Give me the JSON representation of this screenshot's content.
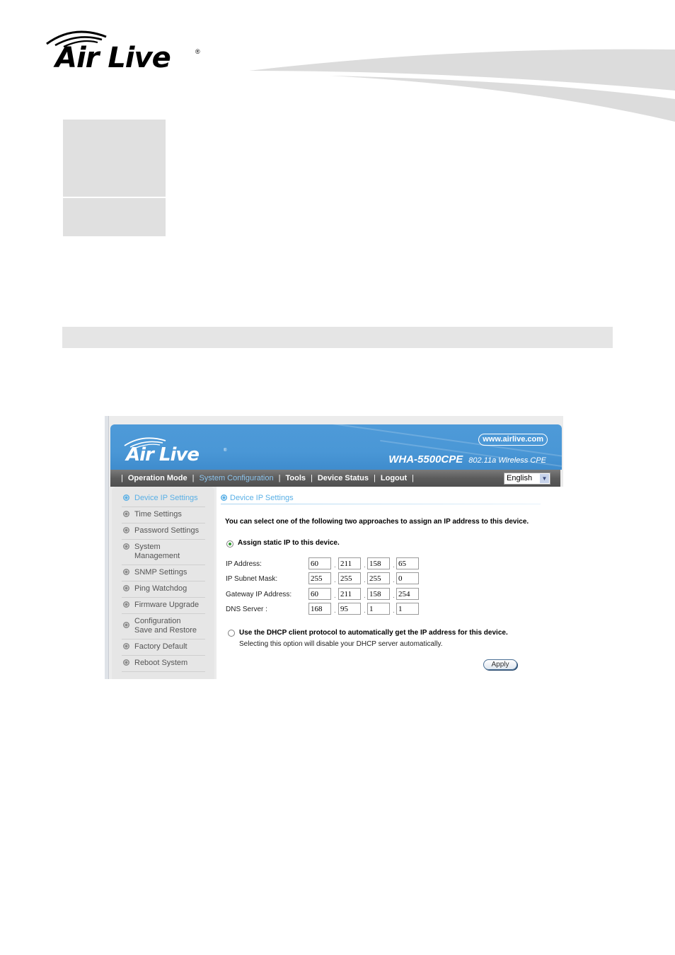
{
  "page": {
    "brand": "Air Live",
    "brand_mark": "®"
  },
  "device_ui": {
    "banner": {
      "brand": "Air Live",
      "brand_mark": "®",
      "url": "www.airlive.com",
      "model": "WHA-5500CPE",
      "model_desc": "802.11a Wireless CPE"
    },
    "nav": {
      "separator": "|",
      "items": [
        {
          "label": "Operation Mode",
          "active": false
        },
        {
          "label": "System Configuration",
          "active": true
        },
        {
          "label": "Tools",
          "active": false
        },
        {
          "label": "Device Status",
          "active": false
        },
        {
          "label": "Logout",
          "active": false
        }
      ],
      "language": {
        "selected": "English",
        "arrow_icon": "chevron-down"
      }
    },
    "sidebar": {
      "items": [
        {
          "label": "Device IP Settings",
          "active": true
        },
        {
          "label": "Time Settings"
        },
        {
          "label": "Password Settings"
        },
        {
          "label": "System Management"
        },
        {
          "label": "SNMP Settings"
        },
        {
          "label": "Ping Watchdog"
        },
        {
          "label": "Firmware Upgrade"
        },
        {
          "label_line1": "Configuration",
          "label_line2": "Save and Restore"
        },
        {
          "label": "Factory Default"
        },
        {
          "label": "Reboot System"
        }
      ]
    },
    "content": {
      "section_title": "Device IP Settings",
      "intro": "You can select one of the following two approaches to assign an IP address to this device.",
      "static_option": {
        "label": "Assign static IP to this device.",
        "checked": true
      },
      "fields": [
        {
          "label": "IP Address:",
          "octets": [
            "60",
            "211",
            "158",
            "65"
          ]
        },
        {
          "label": "IP Subnet Mask:",
          "octets": [
            "255",
            "255",
            "255",
            "0"
          ]
        },
        {
          "label": "Gateway IP Address:",
          "octets": [
            "60",
            "211",
            "158",
            "254"
          ]
        },
        {
          "label": "DNS Server :",
          "octets": [
            "168",
            "95",
            "1",
            "1"
          ]
        }
      ],
      "octet_separator": ".",
      "dhcp_option": {
        "label": "Use the DHCP client protocol to automatically get the IP address for this device.",
        "note": "Selecting this option will disable your DHCP server automatically.",
        "checked": false
      },
      "apply_label": "Apply"
    }
  }
}
